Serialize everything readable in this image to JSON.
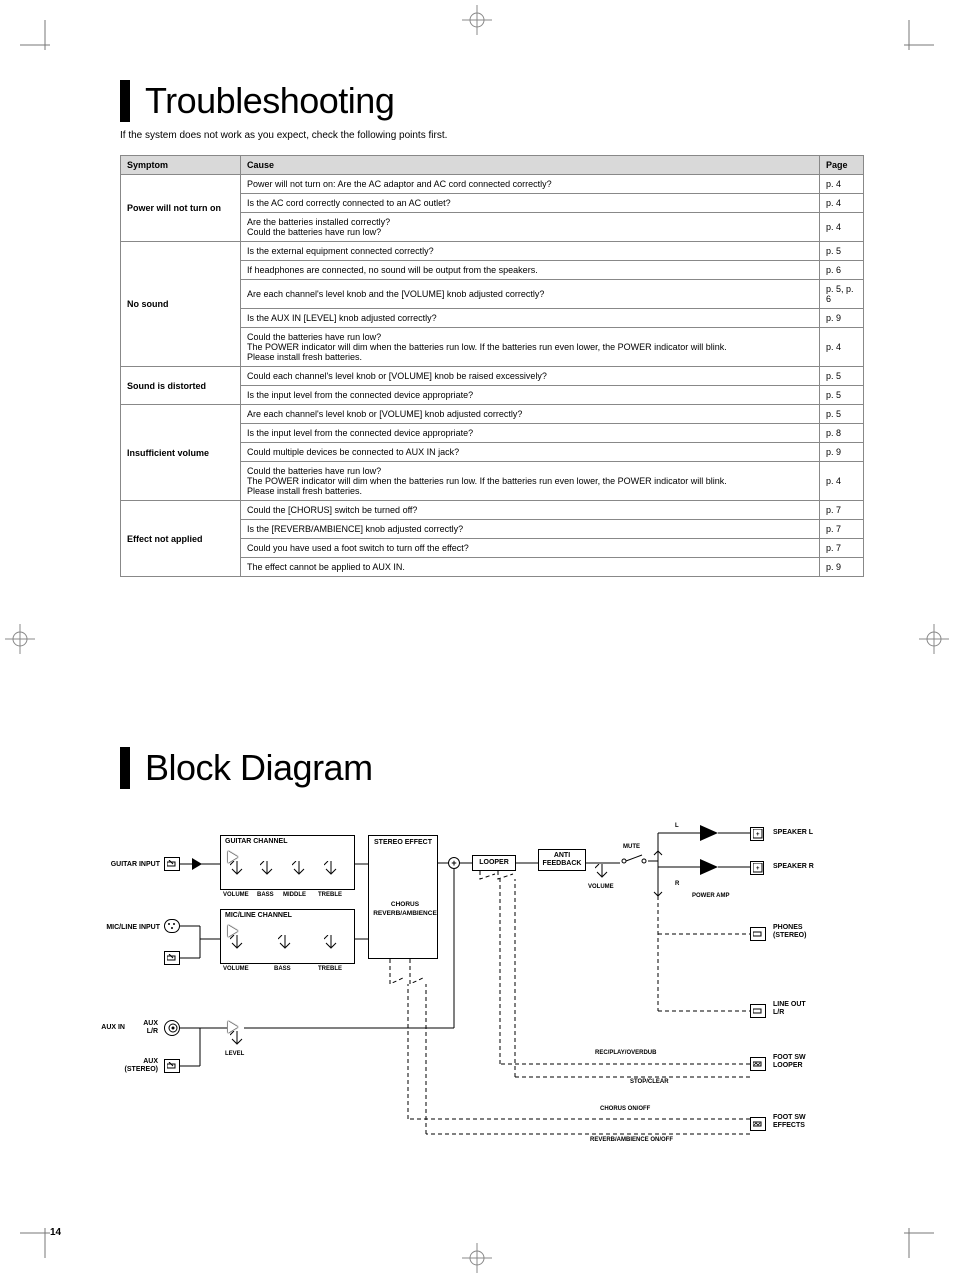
{
  "section1": {
    "heading": "Troubleshooting",
    "intro": "If the system does not work as you expect, check the following points first.",
    "headers": {
      "symptom": "Symptom",
      "cause": "Cause",
      "page": "Page"
    },
    "groups": [
      {
        "symptom": "Power will not turn on",
        "rows": [
          {
            "cause": "Power will not turn on: Are the AC adaptor and AC cord connected correctly?",
            "page": "p. 4"
          },
          {
            "cause": "Is the AC cord correctly connected to an AC outlet?",
            "page": "p. 4"
          },
          {
            "cause": "Are the batteries installed correctly?\nCould the batteries have run low?",
            "page": "p. 4"
          }
        ]
      },
      {
        "symptom": "No sound",
        "rows": [
          {
            "cause": "Is the external equipment connected correctly?",
            "page": "p. 5"
          },
          {
            "cause": "If headphones are connected, no sound will be output from the speakers.",
            "page": "p. 6"
          },
          {
            "cause": "Are each channel's level knob and the [VOLUME] knob adjusted correctly?",
            "page": "p. 5, p. 6"
          },
          {
            "cause": "Is the AUX IN [LEVEL] knob adjusted correctly?",
            "page": "p. 9"
          },
          {
            "cause": "Could the batteries have run low?\nThe POWER indicator will dim when the batteries run low. If the batteries run even lower, the POWER indicator will blink.\nPlease install fresh batteries.",
            "page": "p. 4"
          }
        ]
      },
      {
        "symptom": "Sound is distorted",
        "rows": [
          {
            "cause": "Could each channel's level knob or [VOLUME] knob be raised excessively?",
            "page": "p. 5"
          },
          {
            "cause": "Is the input level from the connected device appropriate?",
            "page": "p. 5"
          }
        ]
      },
      {
        "symptom": "Insufficient volume",
        "rows": [
          {
            "cause": "Are each channel's level knob or [VOLUME] knob adjusted correctly?",
            "page": "p. 5"
          },
          {
            "cause": "Is the input level from the connected device appropriate?",
            "page": "p. 8"
          },
          {
            "cause": "Could multiple devices be connected to AUX IN jack?",
            "page": "p. 9"
          },
          {
            "cause": "Could the batteries have run low?\nThe POWER indicator will dim when the batteries run low. If the batteries run even lower, the POWER indicator will blink.\nPlease install fresh batteries.",
            "page": "p. 4"
          }
        ]
      },
      {
        "symptom": "Effect not applied",
        "rows": [
          {
            "cause": "Could the [CHORUS] switch be turned off?",
            "page": "p. 7"
          },
          {
            "cause": "Is the [REVERB/AMBIENCE] knob adjusted correctly?",
            "page": "p. 7"
          },
          {
            "cause": "Could you have used a foot switch to turn off the effect?",
            "page": "p. 7"
          },
          {
            "cause": "The effect cannot be applied to AUX IN.",
            "page": "p. 9"
          }
        ]
      }
    ]
  },
  "section2": {
    "heading": "Block Diagram",
    "labels": {
      "guitar_input": "GUITAR INPUT",
      "micline_input": "MIC/LINE INPUT",
      "aux_in": "AUX IN",
      "aux_lr": "AUX\nL/R",
      "aux_stereo": "AUX\n(STEREO)",
      "guitar_channel": "GUITAR CHANNEL",
      "micline_channel": "MIC/LINE CHANNEL",
      "volume": "VOLUME",
      "bass": "BASS",
      "middle": "MIDDLE",
      "treble": "TREBLE",
      "level": "LEVEL",
      "stereo_effect": "STEREO EFFECT",
      "chorus": "CHORUS",
      "reverb_amb": "REVERB/AMBIENCE",
      "looper": "LOOPER",
      "anti_feedback": "ANTI\nFEEDBACK",
      "mute": "MUTE",
      "l": "L",
      "r": "R",
      "power_amp": "POWER AMP",
      "speaker_l": "SPEAKER L",
      "speaker_r": "SPEAKER R",
      "phones": "PHONES\n(STEREO)",
      "line_out": "LINE OUT\nL/R",
      "foot_sw_looper": "FOOT SW\nLOOPER",
      "foot_sw_effects": "FOOT SW\nEFFECTS",
      "rec_play": "REC/PLAY/OVERDUB",
      "stop_clear": "STOP/CLEAR",
      "chorus_onoff": "CHORUS ON/OFF",
      "reverb_onoff": "REVERB/AMBIENCE ON/OFF"
    }
  },
  "page_number": "14"
}
